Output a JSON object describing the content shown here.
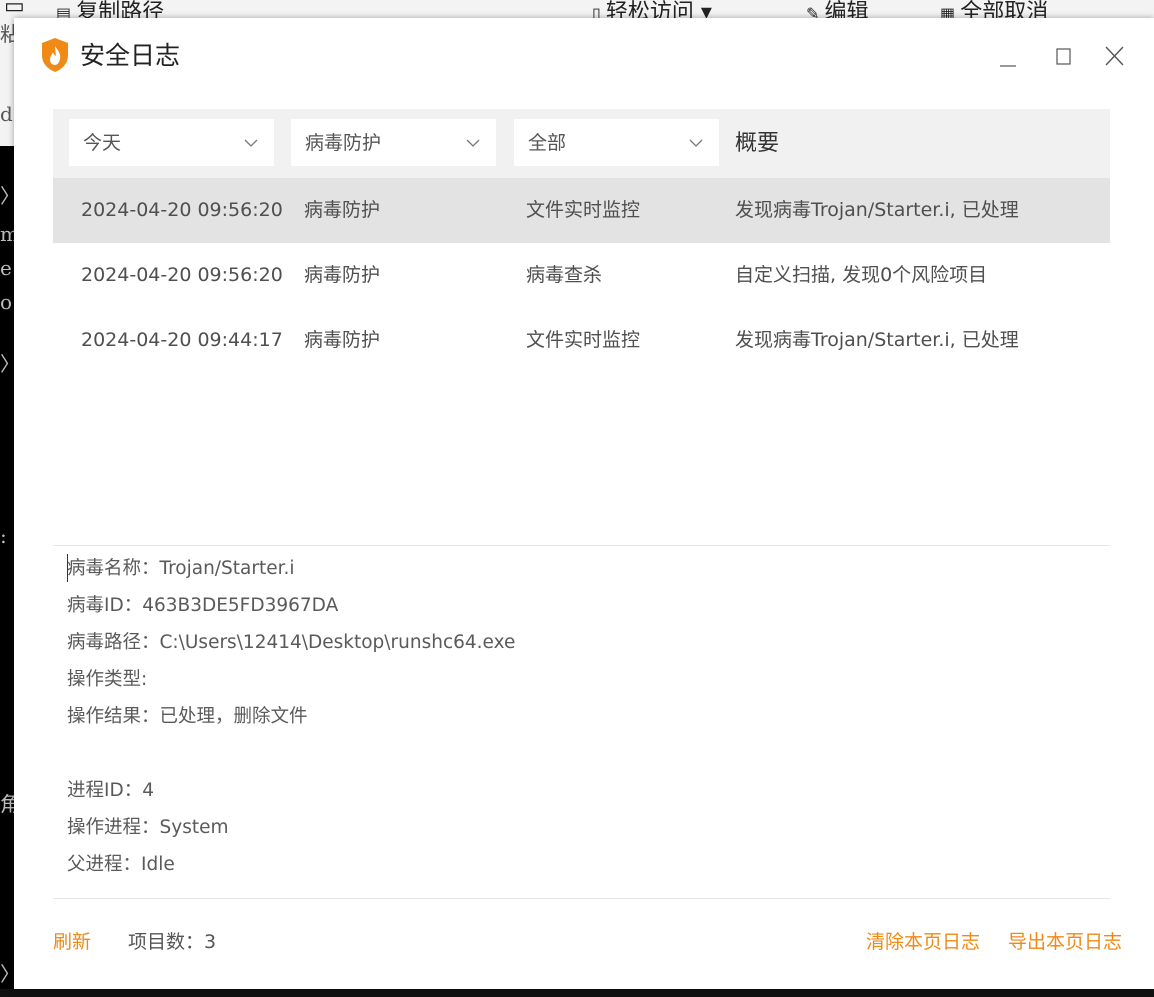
{
  "background": {
    "ribbon_items": [
      {
        "label": "复制路径",
        "icon": "copy-path-icon"
      },
      {
        "label": "轻松访问 ▾",
        "icon": "easy-access-icon"
      },
      {
        "label": "编辑",
        "icon": "edit-icon"
      },
      {
        "label": "全部取消",
        "icon": "select-none-icon"
      }
    ],
    "left_glyphs_top": [
      "粘",
      "d"
    ],
    "left_glyphs": [
      "〉",
      "m",
      "e",
      "o",
      "〉",
      ":",
      "角",
      "〉"
    ]
  },
  "window": {
    "title": "安全日志",
    "logo_icon": "flame-shield-icon",
    "colors": {
      "accent": "#f08a16",
      "selected_row": "#e3e3e3",
      "header_bg": "#f1f1f1"
    }
  },
  "filters": {
    "time": "今天",
    "module": "病毒防护",
    "scope": "全部",
    "summary_header": "概要"
  },
  "logs": [
    {
      "time": "2024-04-20 09:56:20",
      "module": "病毒防护",
      "type": "文件实时监控",
      "summary": "发现病毒Trojan/Starter.i, 已处理",
      "selected": true
    },
    {
      "time": "2024-04-20 09:56:20",
      "module": "病毒防护",
      "type": "病毒查杀",
      "summary": "自定义扫描, 发现0个风险项目",
      "selected": false
    },
    {
      "time": "2024-04-20 09:44:17",
      "module": "病毒防护",
      "type": "文件实时监控",
      "summary": "发现病毒Trojan/Starter.i, 已处理",
      "selected": false
    }
  ],
  "details": {
    "virus_name": "病毒名称：Trojan/Starter.i",
    "virus_id": "病毒ID：463B3DE5FD3967DA",
    "virus_path": "病毒路径：C:\\Users\\12414\\Desktop\\runshc64.exe",
    "op_type": "操作类型:",
    "op_result": "操作结果：已处理，删除文件",
    "process_id": "进程ID：4",
    "process": "操作进程：System",
    "parent_process": "父进程：Idle"
  },
  "footer": {
    "refresh": "刷新",
    "count": "项目数：3",
    "clear": "清除本页日志",
    "export": "导出本页日志"
  }
}
